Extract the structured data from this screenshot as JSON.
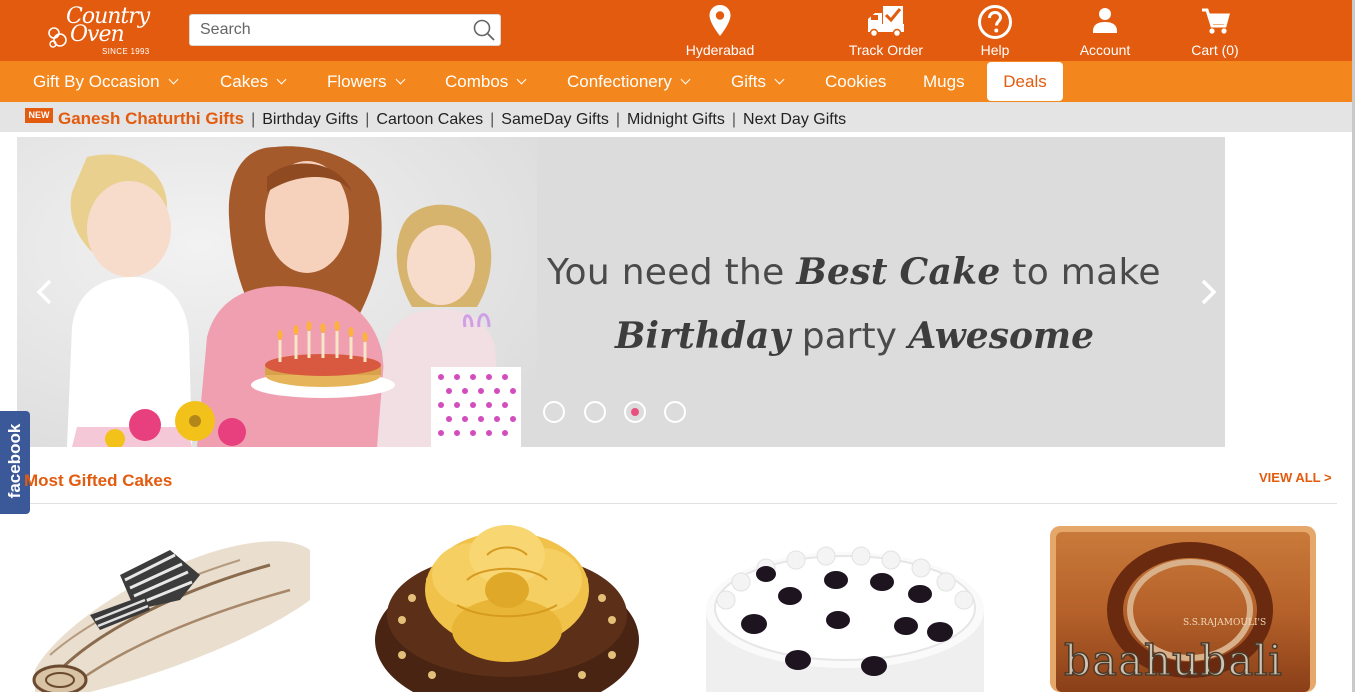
{
  "header": {
    "logo": {
      "line1": "Country",
      "line2": "Oven",
      "tagline": "SINCE 1993"
    },
    "search": {
      "placeholder": "Search"
    },
    "nav": [
      {
        "label": "Hyderabad",
        "icon": "location-pin-icon"
      },
      {
        "label": "Track Order",
        "icon": "delivery-truck-icon"
      },
      {
        "label": "Help",
        "icon": "help-icon"
      },
      {
        "label": "Account",
        "icon": "user-icon"
      },
      {
        "label": "Cart (0)",
        "icon": "cart-icon"
      }
    ]
  },
  "menu": {
    "items": [
      "Gift By Occasion",
      "Cakes",
      "Flowers",
      "Combos",
      "Confectionery",
      "Gifts",
      "Cookies",
      "Mugs"
    ],
    "deals": "Deals"
  },
  "quickbar": {
    "badge": "NEW",
    "highlight": "Ganesh Chaturthi Gifts",
    "links": [
      "Birthday Gifts",
      "Cartoon Cakes",
      "SameDay Gifts",
      "Midnight Gifts",
      "Next Day Gifts"
    ],
    "separator": "|"
  },
  "banner": {
    "line1_pre": "You need the ",
    "line1_em1": "Best",
    "line1_em2": "Cake",
    "line1_post": " to make",
    "line2_em1": "Birthday",
    "line2_mid": " party ",
    "line2_em2": "Awesome",
    "slides_total": 4,
    "active_slide": 3
  },
  "social": {
    "facebook": "facebook"
  },
  "section": {
    "title": "Most Gifted Cakes",
    "view_all": "VIEW ALL >",
    "product_images": [
      "chocolate-swiss-roll-cake",
      "chocolate-flower-cake",
      "black-forest-cake",
      "bahubali-photo-cake"
    ],
    "bahubali_text": "baahubali"
  },
  "colors": {
    "topbar": "#e25b0e",
    "menubar": "#f3871d",
    "accent": "#e25b0e",
    "dot_active": "#e8517f",
    "facebook": "#3b5998"
  }
}
